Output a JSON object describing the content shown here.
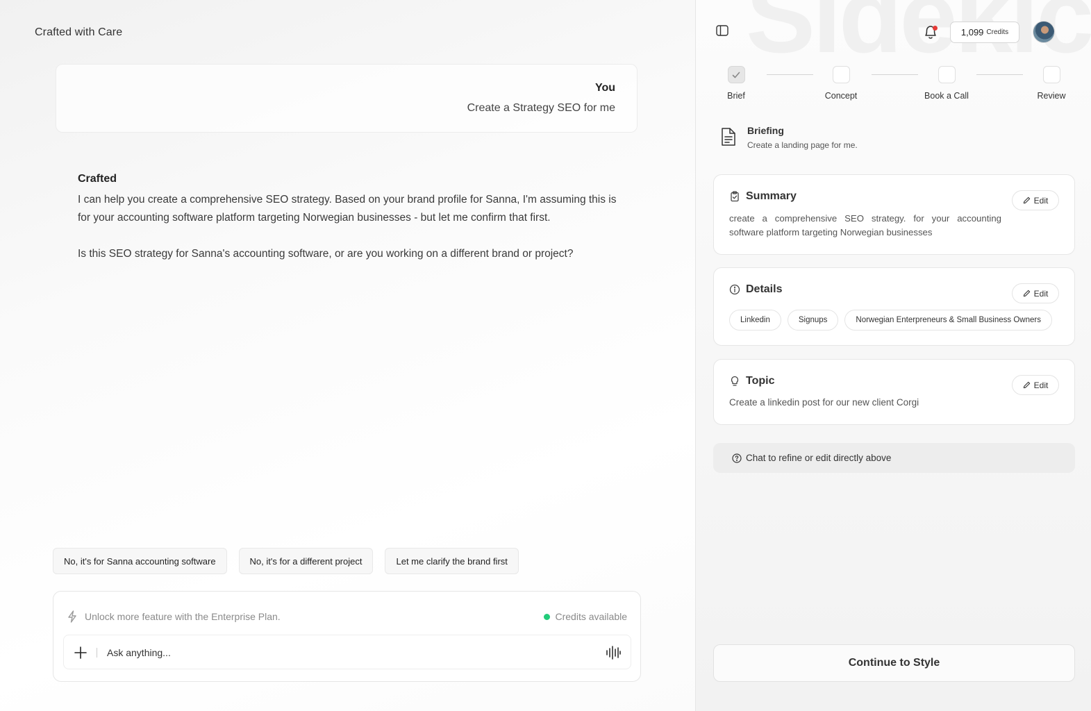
{
  "app": {
    "title": "Crafted with Care"
  },
  "chat": {
    "user": {
      "name": "You",
      "message": "Create a Strategy SEO for me"
    },
    "assistant": {
      "name": "Crafted",
      "paragraphs": [
        "I can help you create a comprehensive SEO strategy. Based on your brand profile for Sanna, I'm assuming this is for your accounting software platform targeting Norwegian businesses - but let me confirm that first.",
        "Is this SEO strategy for Sanna's accounting software, or are you working on a different brand or project?"
      ]
    },
    "suggestions": [
      "No, it's for Sanna accounting software",
      "No, it's for a different project",
      "Let me clarify the brand first"
    ]
  },
  "composer": {
    "promo": "Unlock more feature with the Enterprise Plan.",
    "credits_status": "Credits available",
    "placeholder": "Ask anything..."
  },
  "side": {
    "watermark": "Sidekic",
    "credits": {
      "amount": "1,099",
      "label": "Credits"
    },
    "steps": [
      {
        "label": "Brief",
        "done": true
      },
      {
        "label": "Concept",
        "done": false
      },
      {
        "label": "Book a Call",
        "done": false
      },
      {
        "label": "Review",
        "done": false
      }
    ],
    "briefing": {
      "title": "Briefing",
      "subtitle": "Create a landing page for me."
    },
    "edit_label": "Edit",
    "summary": {
      "title": "Summary",
      "text": "create a comprehensive SEO strategy. for your accounting software platform targeting Norwegian businesses"
    },
    "details": {
      "title": "Details",
      "tags": [
        "Linkedin",
        "Signups",
        "Norwegian Enterpreneurs & Small Business Owners"
      ]
    },
    "topic": {
      "title": "Topic",
      "text": "Create a linkedin post for our new client Corgi"
    },
    "hint": "Chat to refine or edit directly above",
    "continue_label": "Continue to Style"
  },
  "colors": {
    "accent_green": "#22cc7a",
    "notification_red": "#e53935"
  },
  "icons": {
    "sidebar_toggle": "sidebar-toggle-icon",
    "bell": "bell-icon",
    "document": "document-icon",
    "clipboard": "clipboard-icon",
    "info": "info-icon",
    "lightbulb": "lightbulb-icon",
    "pencil": "pencil-icon",
    "help": "help-circle-icon",
    "bolt": "bolt-icon",
    "plus": "plus-icon",
    "voice": "voice-wave-icon",
    "check": "check-icon"
  }
}
